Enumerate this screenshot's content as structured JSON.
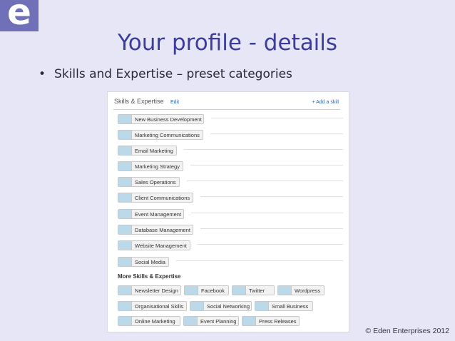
{
  "logo": {
    "letter": "e"
  },
  "slide": {
    "title": "Your profile - details",
    "bullet": "Skills and Expertise – preset categories"
  },
  "panel": {
    "header": "Skills & Expertise",
    "edit_label": "Edit",
    "add_skill_label": "+ Add a skill",
    "skills": [
      "New Business Development",
      "Marketing Communications",
      "Email Marketing",
      "Marketing Strategy",
      "Sales Operations",
      "Client Communications",
      "Event Management",
      "Database Management",
      "Website Management",
      "Social Media"
    ],
    "more_title": "More Skills & Expertise",
    "more_skills_rows": [
      [
        "Newsletter Design",
        "Facebook",
        "Twitter",
        "Wordpress"
      ],
      [
        "Organisational Skills",
        "Social Networking",
        "Small Business"
      ],
      [
        "Online Marketing",
        "Event Planning",
        "Press Releases"
      ]
    ]
  },
  "footer": "© Eden Enterprises 2012",
  "colors": {
    "slide_bg": "#e6e6f7",
    "title": "#3b3c9c",
    "logo_bg": "#6f70b8",
    "link": "#2a64b0",
    "pill_count": "#bcd9ea"
  }
}
